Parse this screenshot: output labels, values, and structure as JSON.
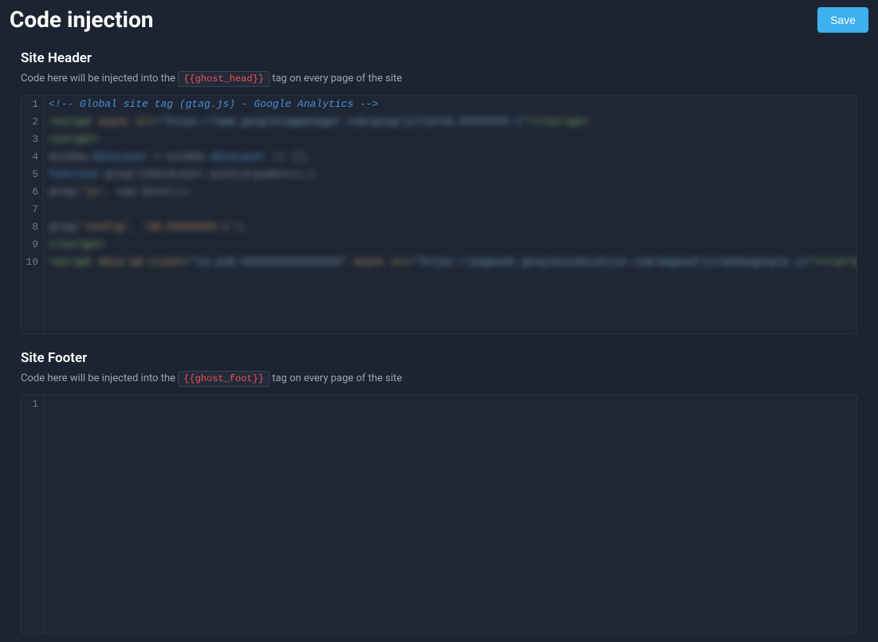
{
  "page": {
    "title": "Code injection",
    "save_label": "Save"
  },
  "sections": {
    "header": {
      "title": "Site Header",
      "desc_before": "Code here will be injected into the ",
      "tag": "{{ghost_head}}",
      "desc_after": " tag on every page of the site",
      "lines": [
        {
          "n": 1,
          "type": "comment",
          "text": "<!-- Global site tag (gtag.js) - Google Analytics -->"
        },
        {
          "n": 2,
          "type": "blur",
          "tokens": [
            {
              "cls": "tok-green",
              "t": "<script "
            },
            {
              "cls": "tok-attr",
              "t": "async "
            },
            {
              "cls": "tok-attr",
              "t": "src"
            },
            {
              "cls": "tok-gray",
              "t": "="
            },
            {
              "cls": "tok-string",
              "t": "\"https://www.googletagmanager.com/gtag/js?id=UA-XXXXXXXX-1\""
            },
            {
              "cls": "tok-green",
              "t": "></script>"
            }
          ]
        },
        {
          "n": 3,
          "type": "blur",
          "tokens": [
            {
              "cls": "tok-green",
              "t": "<script>"
            }
          ]
        },
        {
          "n": 4,
          "type": "blur",
          "tokens": [
            {
              "cls": "tok-gray",
              "t": "  window."
            },
            {
              "cls": "tok-blue",
              "t": "dataLayer"
            },
            {
              "cls": "tok-gray",
              "t": " = window."
            },
            {
              "cls": "tok-blue",
              "t": "dataLayer"
            },
            {
              "cls": "tok-gray",
              "t": " || [];"
            }
          ]
        },
        {
          "n": 5,
          "type": "blur",
          "tokens": [
            {
              "cls": "tok-gray",
              "t": "  "
            },
            {
              "cls": "tok-blue",
              "t": "function"
            },
            {
              "cls": "tok-gray",
              "t": " gtag(){dataLayer.push(arguments);}"
            }
          ]
        },
        {
          "n": 6,
          "type": "blur",
          "tokens": [
            {
              "cls": "tok-gray",
              "t": "  gtag("
            },
            {
              "cls": "tok-orange",
              "t": "'js'"
            },
            {
              "cls": "tok-gray",
              "t": ", new Date());"
            }
          ]
        },
        {
          "n": 7,
          "type": "empty",
          "text": ""
        },
        {
          "n": 8,
          "type": "blur",
          "tokens": [
            {
              "cls": "tok-gray",
              "t": "  gtag("
            },
            {
              "cls": "tok-orange",
              "t": "'config'"
            },
            {
              "cls": "tok-gray",
              "t": ", "
            },
            {
              "cls": "tok-orange",
              "t": "'UA-XXXXXXXX-1'"
            },
            {
              "cls": "tok-gray",
              "t": ");"
            }
          ]
        },
        {
          "n": 9,
          "type": "blur",
          "tokens": [
            {
              "cls": "tok-green",
              "t": "</script>"
            }
          ]
        },
        {
          "n": 10,
          "type": "blur",
          "tokens": [
            {
              "cls": "tok-green",
              "t": "<script "
            },
            {
              "cls": "tok-attr",
              "t": "data-ad-client"
            },
            {
              "cls": "tok-gray",
              "t": "="
            },
            {
              "cls": "tok-string",
              "t": "\"ca-pub-XXXXXXXXXXXXXXXX\""
            },
            {
              "cls": "tok-gray",
              "t": " "
            },
            {
              "cls": "tok-attr",
              "t": "async "
            },
            {
              "cls": "tok-attr",
              "t": "src"
            },
            {
              "cls": "tok-gray",
              "t": "="
            },
            {
              "cls": "tok-string",
              "t": "\"https://pagead2.googlesyndication.com/pagead/js/adsbygoogle.js\""
            },
            {
              "cls": "tok-green",
              "t": "></script>"
            }
          ]
        }
      ]
    },
    "footer": {
      "title": "Site Footer",
      "desc_before": "Code here will be injected into the ",
      "tag": "{{ghost_foot}}",
      "desc_after": " tag on every page of the site",
      "lines": [
        {
          "n": 1,
          "type": "empty",
          "text": ""
        }
      ]
    }
  }
}
